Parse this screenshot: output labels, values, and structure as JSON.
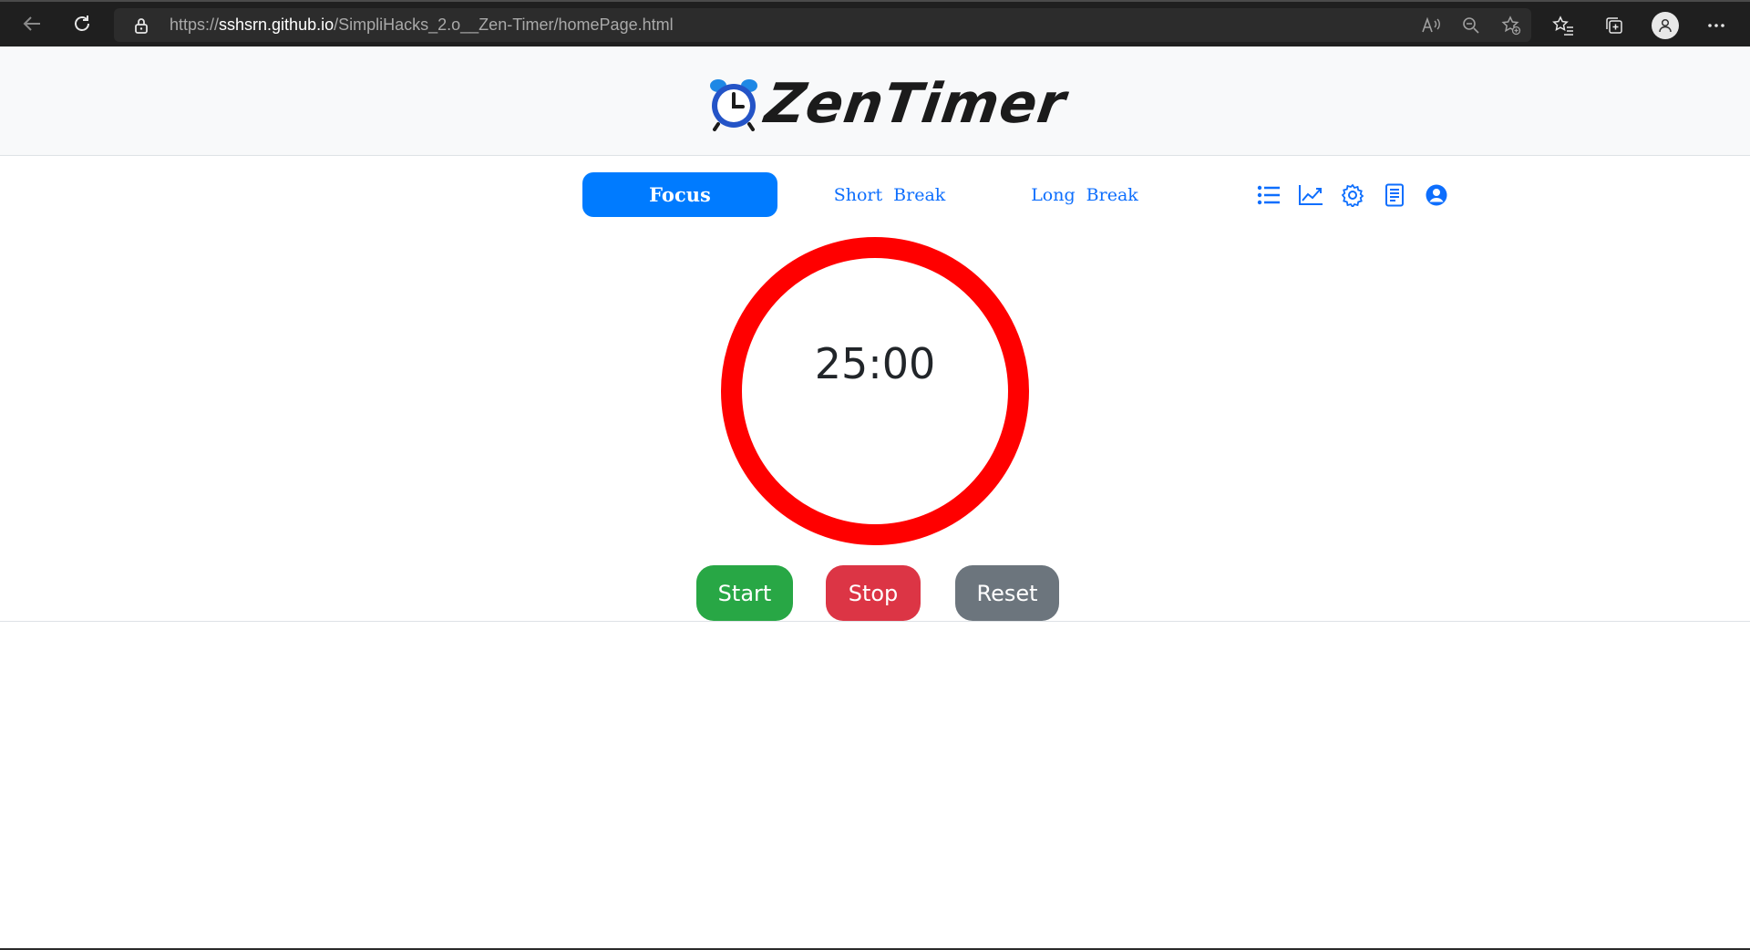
{
  "browser": {
    "url_scheme": "https://",
    "url_host": "sshsrn.github.io",
    "url_path": "/SimpliHacks_2.o__Zen-Timer/homePage.html"
  },
  "header": {
    "logo_text": "ZenTimer"
  },
  "tabs": [
    {
      "label": "Focus",
      "active": true
    },
    {
      "label": "Short Break",
      "active": false
    },
    {
      "label": "Long Break",
      "active": false
    }
  ],
  "tool_icons": [
    "list-icon",
    "chart-line-icon",
    "gear-icon",
    "notes-icon",
    "user-circle-icon"
  ],
  "timer": {
    "display": "25:00"
  },
  "controls": {
    "start_label": "Start",
    "stop_label": "Stop",
    "reset_label": "Reset"
  },
  "colors": {
    "accent": "#007bff",
    "ring": "#ff0000",
    "start": "#28a745",
    "stop": "#dc3545",
    "reset": "#6c757d"
  }
}
